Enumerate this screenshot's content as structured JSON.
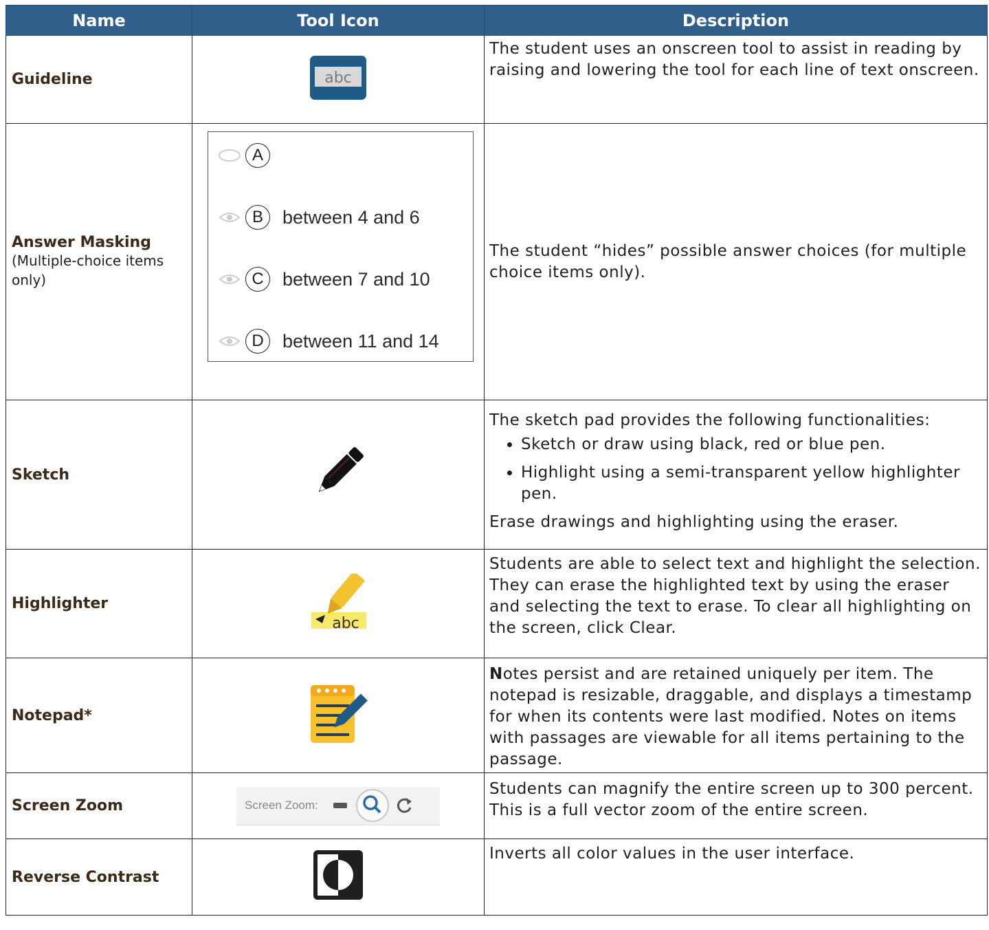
{
  "headers": {
    "name": "Name",
    "icon": "Tool Icon",
    "desc": "Description"
  },
  "rows": {
    "guideline": {
      "name": "Guideline",
      "icon_text": "abc",
      "desc": "The student uses an onscreen tool to assist in reading by raising and lowering the tool for each line of text onscreen."
    },
    "masking": {
      "name": "Answer Masking",
      "sub": "(Multiple-choice items only)",
      "options": [
        {
          "letter": "A",
          "text": ""
        },
        {
          "letter": "B",
          "text": "between 4 and 6"
        },
        {
          "letter": "C",
          "text": "between 7 and 10"
        },
        {
          "letter": "D",
          "text": "between 11 and 14"
        }
      ],
      "desc": "The student “hides” possible answer choices (for multiple choice items only)."
    },
    "sketch": {
      "name": "Sketch",
      "desc_intro": "The sketch pad provides the following functionalities:",
      "bullets": [
        "Sketch or draw using black, red or blue pen.",
        "Highlight using a semi-transparent yellow highlighter pen."
      ],
      "desc_outro": "Erase drawings and highlighting using the eraser."
    },
    "highlighter": {
      "name": "Highlighter",
      "icon_text": "abc",
      "desc": "Students are able to select text and highlight the selection. They can erase the highlighted text by using the eraser and selecting the text to erase. To clear all highlighting on the screen, click Clear."
    },
    "notepad": {
      "name": "Notepad*",
      "desc_first": "N",
      "desc": "otes persist and are retained uniquely per item. The notepad is resizable, draggable, and displays a timestamp for when its contents were last modified. Notes on items with passages are viewable for all items pertaining to the passage."
    },
    "zoom": {
      "name": "Screen Zoom",
      "icon_label": "Screen Zoom:",
      "desc": "Students can magnify the entire screen up to 300 percent. This is a full vector zoom of the entire screen."
    },
    "contrast": {
      "name": "Reverse Contrast",
      "desc": "Inverts all color values in the user interface."
    }
  },
  "colors": {
    "header_bg": "#2f5f8a",
    "icon_blue": "#1e5b86",
    "highlight_yellow": "#f2c230",
    "notepad_yellow": "#f6c12c"
  }
}
